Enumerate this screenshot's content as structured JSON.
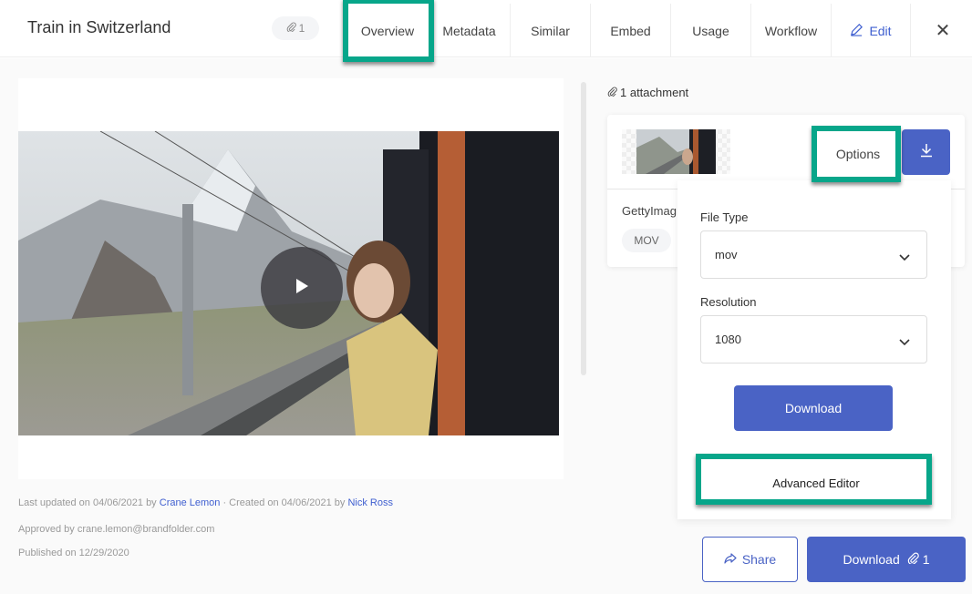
{
  "header": {
    "title": "Train in Switzerland",
    "attachment_count": "1",
    "tabs": [
      {
        "label": "Overview",
        "active": true
      },
      {
        "label": "Metadata"
      },
      {
        "label": "Similar"
      },
      {
        "label": "Embed"
      },
      {
        "label": "Usage"
      },
      {
        "label": "Workflow"
      }
    ],
    "edit_label": "Edit",
    "close_label": "✕"
  },
  "meta": {
    "updated_prefix": "Last updated on 04/06/2021 by ",
    "updated_by": "Crane Lemon",
    "created_prefix": " · Created on 04/06/2021 by ",
    "created_by": "Nick Ross",
    "approved": "Approved by crane.lemon@brandfolder.com",
    "published": "Published on 12/29/2020"
  },
  "attachments": {
    "count_label": "1 attachment",
    "file_name": "GettyImag",
    "extension": "MOV",
    "options_label": "Options"
  },
  "options_dropdown": {
    "file_type_label": "File Type",
    "file_type_value": "mov",
    "resolution_label": "Resolution",
    "resolution_value": "1080",
    "download_label": "Download",
    "advanced_editor_label": "Advanced Editor"
  },
  "footer": {
    "share_label": "Share",
    "download_label": "Download",
    "download_count": "1"
  },
  "colors": {
    "accent": "#4a63c5",
    "highlight": "#07a68a",
    "link": "#3f5fd0"
  }
}
